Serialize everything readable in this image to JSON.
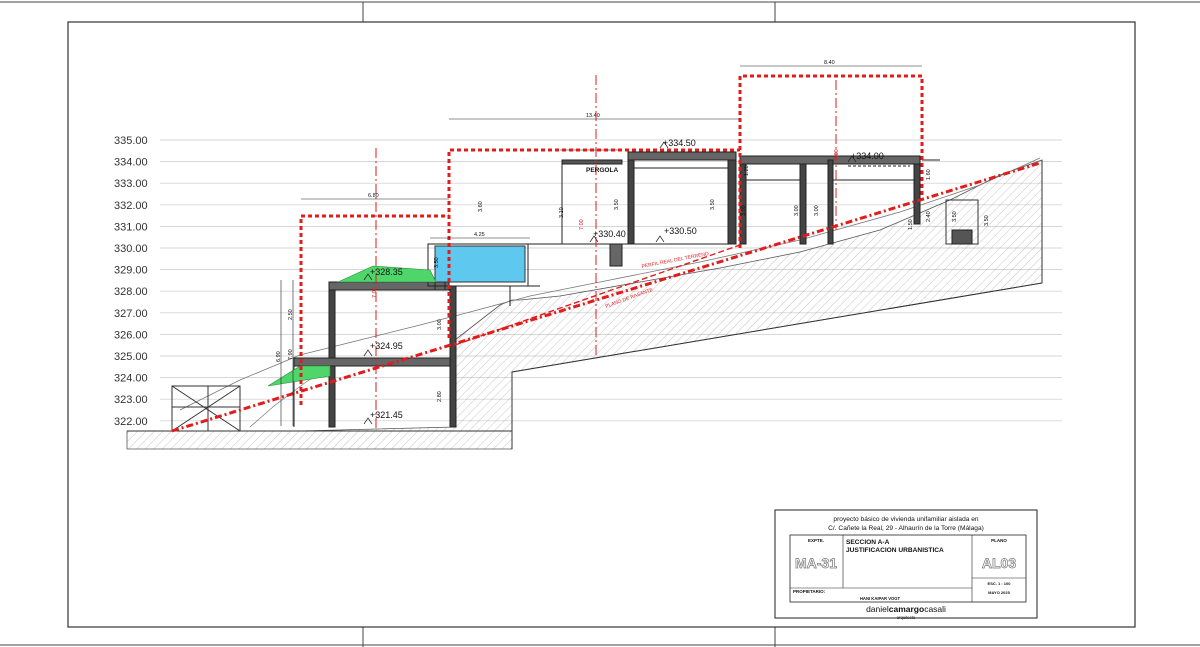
{
  "levels": [
    "335.00",
    "334.00",
    "333.00",
    "332.00",
    "331.00",
    "330.00",
    "329.00",
    "328.00",
    "327.00",
    "326.00",
    "325.00",
    "324.00",
    "323.00",
    "322.00"
  ],
  "elevations": {
    "e33450": "+334.50",
    "e33400": "+334.00",
    "e33040": "+330.40",
    "e33050": "+330.50",
    "e32835": "+328.35",
    "e32495": "+324.95",
    "e32145": "+321.45"
  },
  "dimensions": {
    "d_840": "8.40",
    "d_1340": "13.40",
    "d_680": "6.80",
    "d_425": "4.25",
    "d_360": "3.60",
    "d_310": "3.10",
    "d_350a": "3.50",
    "d_350b": "3.50",
    "d_350c": "3.50",
    "d_350d": "3.50",
    "d_350e": "3.50",
    "d_300a": "3.00",
    "d_300b": "3.00",
    "d_300c": "3.00",
    "d_300d": "3.00",
    "d_700a": "7.00",
    "d_700b": "7.00",
    "d_700c": "7.00",
    "d_690": "6.90",
    "d_280": "2.80",
    "d_250": "2.50",
    "d_240": "2.40",
    "d_160": "1.60",
    "d_150": "1.50",
    "d_120": "1.20",
    "d_790": "7.90"
  },
  "labels": {
    "pergola": "PERGOLA",
    "perfil": "PERFIL REAL DEL TERRENO",
    "plano": "PLANO DE RASANTE"
  },
  "title_block": {
    "project_line1": "proyecto básico de vivienda unifamiliar aislada en",
    "project_line2": "C/. Cañete la Real, 29 - Alhaurín de la Torre (Málaga)",
    "expte_label": "EXPTE.",
    "expte_value": "MA-31",
    "title_line1": "SECCION A-A",
    "title_line2": "JUSTIFICACION URBANISTICA",
    "plano_label": "PLANO",
    "plano_value": "AL03",
    "scale": "ESC. 1 : 100",
    "date": "MAYO 2025",
    "owner_label": "PROPIETARIO:",
    "owner_name": "HANI KAIPAR VOGT",
    "brand_pre": "daniel",
    "brand_bold": "camargo",
    "brand_post": "casali",
    "brand_sub": "arquitecto"
  },
  "colors": {
    "limit_red": "#e21b1b",
    "pool_blue": "#5ec8ef",
    "garden_green": "#4fd66a"
  }
}
